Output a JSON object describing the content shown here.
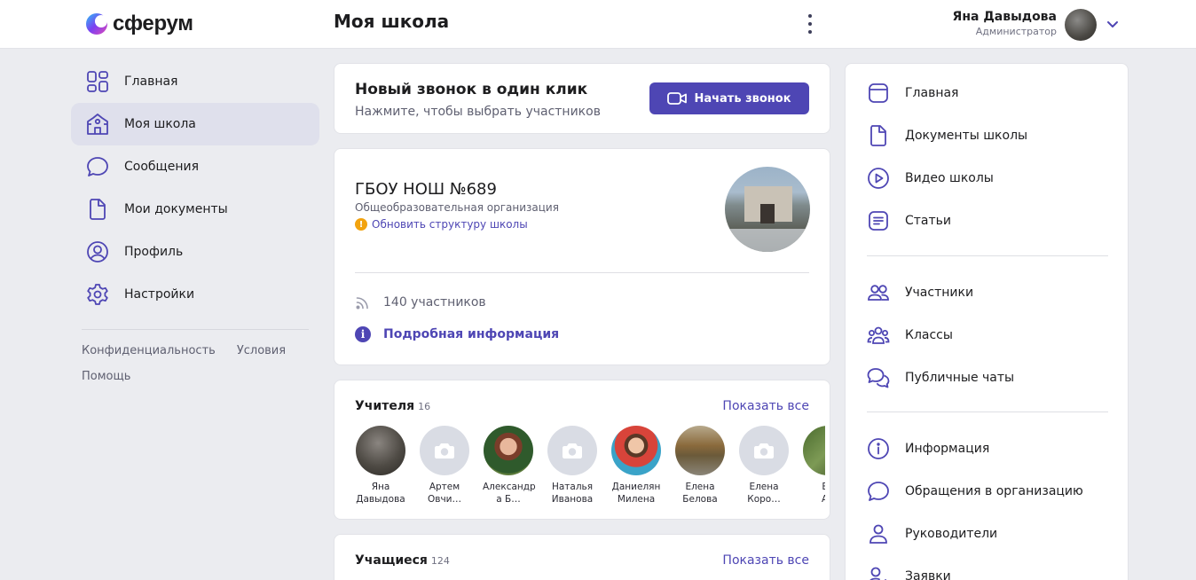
{
  "brand": {
    "name": "сферум",
    "accent": "#4e46b4"
  },
  "header": {
    "page_title": "Моя школа",
    "user_name": "Яна Давыдова",
    "user_role": "Администратор"
  },
  "leftnav": {
    "items": [
      {
        "label": "Главная",
        "icon": "grid-icon"
      },
      {
        "label": "Моя школа",
        "icon": "school-icon",
        "active": true
      },
      {
        "label": "Сообщения",
        "icon": "chat-icon"
      },
      {
        "label": "Мои документы",
        "icon": "document-icon"
      },
      {
        "label": "Профиль",
        "icon": "profile-icon"
      },
      {
        "label": "Настройки",
        "icon": "gear-icon"
      }
    ],
    "footer": {
      "privacy": "Конфиденциальность",
      "terms": "Условия",
      "help": "Помощь"
    }
  },
  "call": {
    "title": "Новый звонок в один клик",
    "subtitle": "Нажмите, чтобы выбрать участников",
    "button": "Начать звонок"
  },
  "school": {
    "name": "ГБОУ НОШ №689",
    "type": "Общеобразовательная организация",
    "update_link": "Обновить структуру школы",
    "members": "140 участников",
    "more_info": "Подробная информация"
  },
  "teachers": {
    "title": "Учителя",
    "count": "16",
    "show_all": "Показать все",
    "people": [
      {
        "name": "Яна\nДавыдова",
        "photo": true
      },
      {
        "name": "Артем\nОвчи…",
        "photo": false
      },
      {
        "name": "Александр\nа Б…",
        "photo": true
      },
      {
        "name": "Наталья\nИванова",
        "photo": false
      },
      {
        "name": "Даниелян\nМилена",
        "photo": true
      },
      {
        "name": "Елена\nБелова",
        "photo": true
      },
      {
        "name": "Елена\nКоро…",
        "photo": false
      },
      {
        "name": "Ел\nАн",
        "photo": true
      }
    ]
  },
  "students": {
    "title": "Учащиеся",
    "count": "124",
    "show_all": "Показать все"
  },
  "rightnav": {
    "group1": [
      {
        "label": "Главная",
        "icon": "home-page-icon"
      },
      {
        "label": "Документы школы",
        "icon": "document-icon"
      },
      {
        "label": "Видео школы",
        "icon": "video-play-icon"
      },
      {
        "label": "Статьи",
        "icon": "article-icon"
      }
    ],
    "group2": [
      {
        "label": "Участники",
        "icon": "users-icon"
      },
      {
        "label": "Классы",
        "icon": "classes-icon"
      },
      {
        "label": "Публичные чаты",
        "icon": "chats-icon"
      }
    ],
    "group3": [
      {
        "label": "Информация",
        "icon": "info-icon"
      },
      {
        "label": "Обращения в организацию",
        "icon": "chat-icon"
      },
      {
        "label": "Руководители",
        "icon": "person-icon"
      },
      {
        "label": "Заявки",
        "icon": "requests-icon"
      }
    ]
  }
}
